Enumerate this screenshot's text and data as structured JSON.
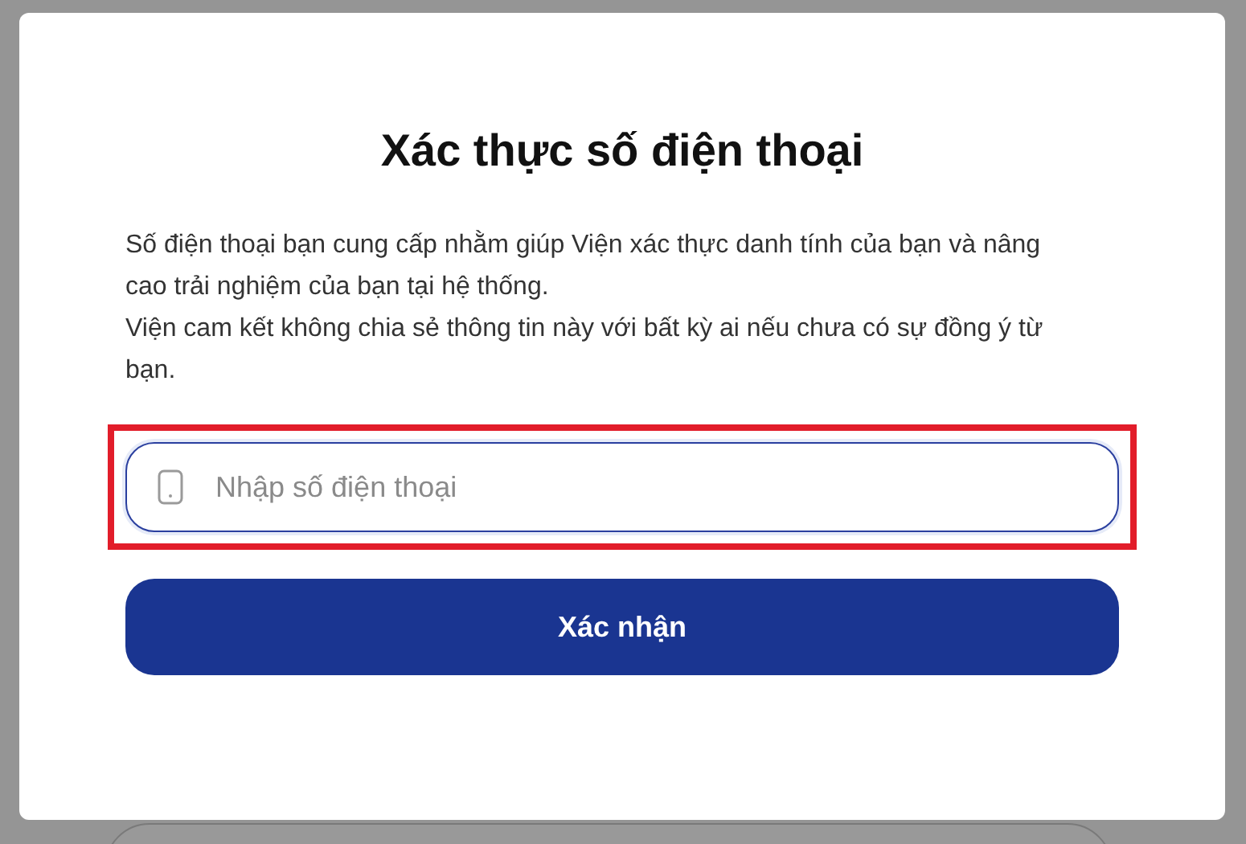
{
  "dialog": {
    "title": "Xác thực số điện thoại",
    "paragraphs": [
      "Số điện thoại bạn cung cấp nhằm giúp Viện xác thực danh tính của bạn và nâng cao trải nghiệm của bạn tại hệ thống.",
      "Viện cam kết không chia sẻ thông tin này với bất kỳ ai nếu chưa có sự đồng ý từ bạn."
    ],
    "phone_field": {
      "placeholder": "Nhập số điện thoại",
      "highlighted": true
    },
    "confirm_button": {
      "label": "Xác nhận"
    }
  }
}
